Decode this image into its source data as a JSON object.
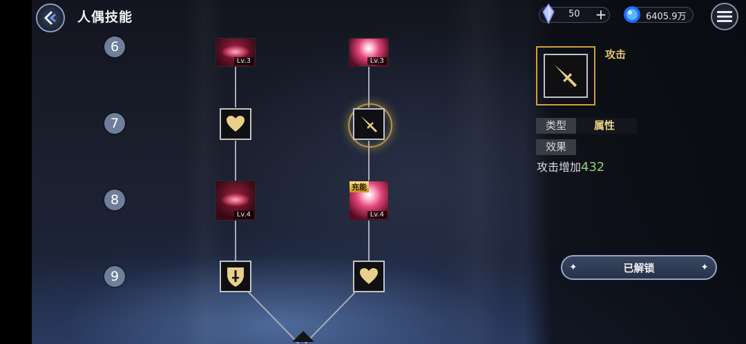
{
  "header": {
    "title": "人偶技能"
  },
  "currency": {
    "crystal": "50",
    "coin": "6405.9万"
  },
  "tree": {
    "rows": [
      "6",
      "7",
      "8",
      "9"
    ],
    "nodes": {
      "r6_left_lv": "Lv.3",
      "r6_right_lv": "Lv.3",
      "r8_left_lv": "Lv.4",
      "r8_right_lv": "Lv.4",
      "r8_right_tag": "充能"
    }
  },
  "detail": {
    "name": "攻击",
    "type_label": "类型",
    "type_value": "属性",
    "effect_label": "效果",
    "effect_text": "攻击增加",
    "effect_value": "432"
  },
  "unlock_button": {
    "label": "已解锁"
  },
  "colors": {
    "gold": "#d3a040",
    "green": "#8fd26a",
    "badge": "#6f7f9a"
  },
  "icons": [
    "back-icon",
    "crystal-icon",
    "plus-icon",
    "coin-orb-icon",
    "menu-icon",
    "heart-icon",
    "dagger-icon",
    "shield-sword-icon",
    "sparkle-icon"
  ]
}
